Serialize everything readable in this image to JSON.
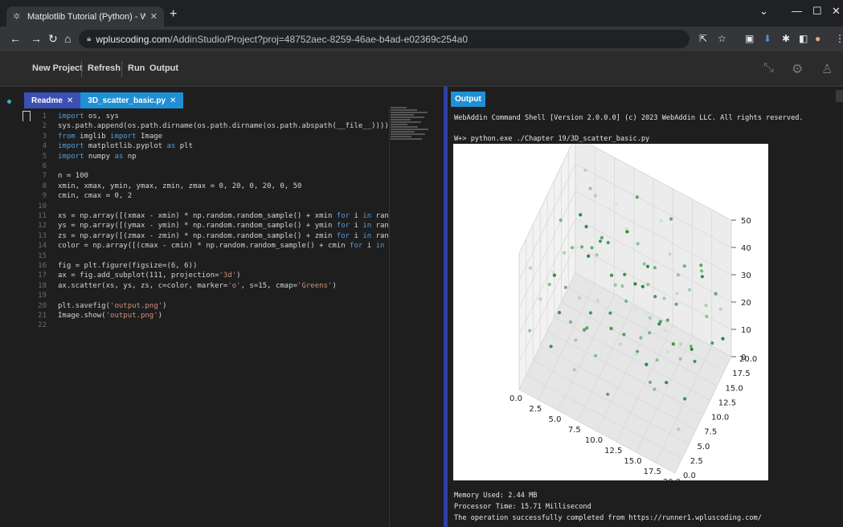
{
  "browser": {
    "tab_title": "Matplotlib Tutorial (Python) - W",
    "url_host": "wpluscoding.com",
    "url_path": "/AddinStudio/Project?proj=48752aec-8259-46ae-b4ad-e02369c254a0",
    "favicon": "wplus-icon"
  },
  "toolbar": {
    "new_project": "New Project",
    "refresh": "Refresh",
    "run": "Run",
    "output": "Output"
  },
  "editor": {
    "tabs": [
      {
        "label": "Readme"
      },
      {
        "label": "3D_scatter_basic.py"
      }
    ],
    "lines": [
      {
        "n": "1",
        "text": "import os, sys"
      },
      {
        "n": "2",
        "text": "sys.path.append(os.path.dirname(os.path.dirname(os.path.abspath(__file__))))"
      },
      {
        "n": "3",
        "text": "from imglib import Image"
      },
      {
        "n": "4",
        "text": "import matplotlib.pyplot as plt"
      },
      {
        "n": "5",
        "text": "import numpy as np"
      },
      {
        "n": "6",
        "text": ""
      },
      {
        "n": "7",
        "text": "n = 100"
      },
      {
        "n": "8",
        "text": "xmin, xmax, ymin, ymax, zmin, zmax = 0, 20, 0, 20, 0, 50"
      },
      {
        "n": "9",
        "text": "cmin, cmax = 0, 2"
      },
      {
        "n": "10",
        "text": ""
      },
      {
        "n": "11",
        "text": "xs = np.array([(xmax - xmin) * np.random.random_sample() + xmin for i in rang"
      },
      {
        "n": "12",
        "text": "ys = np.array([(ymax - ymin) * np.random.random_sample() + ymin for i in rang"
      },
      {
        "n": "13",
        "text": "zs = np.array([(zmax - zmin) * np.random.random_sample() + zmin for i in rang"
      },
      {
        "n": "14",
        "text": "color = np.array([(cmax - cmin) * np.random.random_sample() + cmin for i in r"
      },
      {
        "n": "15",
        "text": ""
      },
      {
        "n": "16",
        "text": "fig = plt.figure(figsize=(6, 6))"
      },
      {
        "n": "17",
        "text": "ax = fig.add_subplot(111, projection='3d')"
      },
      {
        "n": "18",
        "text": "ax.scatter(xs, ys, zs, c=color, marker='o', s=15, cmap='Greens')"
      },
      {
        "n": "19",
        "text": ""
      },
      {
        "n": "20",
        "text": "plt.savefig('output.png')"
      },
      {
        "n": "21",
        "text": "Image.show('output.png')"
      },
      {
        "n": "22",
        "text": ""
      }
    ]
  },
  "output": {
    "tab_label": "Output",
    "header": "WebAddin Command Shell [Version 2.0.0.0] (c) 2023 WebAddin LLC. All rights reserved.",
    "command": "W+> python.exe ./Chapter 19/3D_scatter_basic.py",
    "memory": "Memory Used: 2.44 MB",
    "processor": "Processor Time: 15.71 Millisecond",
    "status": "The operation successfully completed from https://runner1.wpluscoding.com/"
  },
  "chart_data": {
    "type": "scatter",
    "projection": "3d",
    "cmap": "Greens",
    "xlim": [
      0,
      20
    ],
    "ylim": [
      0,
      20
    ],
    "zlim": [
      0,
      50
    ],
    "x_ticks": [
      "0.0",
      "2.5",
      "5.0",
      "7.5",
      "10.0",
      "12.5",
      "15.0",
      "17.5",
      "20.0"
    ],
    "y_ticks": [
      "0.0",
      "2.5",
      "5.0",
      "7.5",
      "10.0",
      "12.5",
      "15.0",
      "17.5",
      "20.0"
    ],
    "z_ticks": [
      "0",
      "10",
      "20",
      "30",
      "40",
      "50"
    ],
    "grid": true,
    "points": [
      {
        "x": 2,
        "y": 18,
        "z": 45,
        "c": 0.5
      },
      {
        "x": 5,
        "y": 15,
        "z": 30,
        "c": 1.6
      },
      {
        "x": 8,
        "y": 12,
        "z": 25,
        "c": 0.8
      },
      {
        "x": 12,
        "y": 8,
        "z": 40,
        "c": 1.9
      },
      {
        "x": 15,
        "y": 5,
        "z": 15,
        "c": 1.2
      },
      {
        "x": 18,
        "y": 3,
        "z": 35,
        "c": 0.3
      },
      {
        "x": 3,
        "y": 6,
        "z": 20,
        "c": 1.7
      },
      {
        "x": 6,
        "y": 3,
        "z": 10,
        "c": 0.6
      },
      {
        "x": 9,
        "y": 17,
        "z": 48,
        "c": 1.4
      },
      {
        "x": 11,
        "y": 14,
        "z": 33,
        "c": 0.9
      },
      {
        "x": 14,
        "y": 11,
        "z": 22,
        "c": 1.8
      },
      {
        "x": 17,
        "y": 9,
        "z": 42,
        "c": 0.4
      },
      {
        "x": 19,
        "y": 16,
        "z": 12,
        "c": 1.5
      },
      {
        "x": 1,
        "y": 12,
        "z": 38,
        "c": 1.1
      },
      {
        "x": 4,
        "y": 9,
        "z": 5,
        "c": 0.7
      },
      {
        "x": 7,
        "y": 19,
        "z": 28,
        "c": 1.9
      },
      {
        "x": 10,
        "y": 2,
        "z": 18,
        "c": 0.2
      },
      {
        "x": 13,
        "y": 18,
        "z": 44,
        "c": 1.3
      },
      {
        "x": 16,
        "y": 13,
        "z": 8,
        "c": 0.8
      },
      {
        "x": 20,
        "y": 7,
        "z": 26,
        "c": 1.6
      },
      {
        "x": 2,
        "y": 2,
        "z": 32,
        "c": 0.5
      },
      {
        "x": 5,
        "y": 10,
        "z": 46,
        "c": 1.8
      },
      {
        "x": 8,
        "y": 5,
        "z": 14,
        "c": 1.0
      },
      {
        "x": 11,
        "y": 20,
        "z": 36,
        "c": 0.3
      },
      {
        "x": 14,
        "y": 16,
        "z": 4,
        "c": 1.7
      },
      {
        "x": 17,
        "y": 1,
        "z": 24,
        "c": 0.9
      },
      {
        "x": 19,
        "y": 12,
        "z": 49,
        "c": 1.4
      },
      {
        "x": 0,
        "y": 16,
        "z": 16,
        "c": 0.6
      },
      {
        "x": 3,
        "y": 14,
        "z": 27,
        "c": 1.2
      },
      {
        "x": 6,
        "y": 8,
        "z": 41,
        "c": 1.9
      },
      {
        "x": 9,
        "y": 11,
        "z": 7,
        "c": 0.4
      },
      {
        "x": 12,
        "y": 4,
        "z": 30,
        "c": 1.5
      },
      {
        "x": 15,
        "y": 19,
        "z": 19,
        "c": 0.7
      },
      {
        "x": 18,
        "y": 15,
        "z": 39,
        "c": 1.1
      },
      {
        "x": 4,
        "y": 1,
        "z": 47,
        "c": 0.2
      },
      {
        "x": 7,
        "y": 13,
        "z": 11,
        "c": 1.6
      },
      {
        "x": 10,
        "y": 9,
        "z": 34,
        "c": 0.8
      },
      {
        "x": 13,
        "y": 6,
        "z": 21,
        "c": 1.3
      },
      {
        "x": 16,
        "y": 17,
        "z": 3,
        "c": 1.9
      },
      {
        "x": 20,
        "y": 2,
        "z": 43,
        "c": 0.5
      },
      {
        "x": 1,
        "y": 8,
        "z": 23,
        "c": 1.0
      },
      {
        "x": 5,
        "y": 19,
        "z": 9,
        "c": 1.7
      },
      {
        "x": 8,
        "y": 16,
        "z": 37,
        "c": 0.3
      },
      {
        "x": 11,
        "y": 1,
        "z": 13,
        "c": 1.4
      },
      {
        "x": 14,
        "y": 7,
        "z": 45,
        "c": 0.9
      },
      {
        "x": 17,
        "y": 18,
        "z": 29,
        "c": 1.8
      },
      {
        "x": 19,
        "y": 4,
        "z": 6,
        "c": 0.6
      },
      {
        "x": 2,
        "y": 11,
        "z": 17,
        "c": 1.2
      },
      {
        "x": 6,
        "y": 15,
        "z": 31,
        "c": 1.5
      },
      {
        "x": 9,
        "y": 3,
        "z": 40,
        "c": 0.4
      },
      {
        "x": 12,
        "y": 12,
        "z": 2,
        "c": 1.9
      },
      {
        "x": 15,
        "y": 10,
        "z": 35,
        "c": 0.7
      },
      {
        "x": 18,
        "y": 20,
        "z": 20,
        "c": 1.3
      },
      {
        "x": 3,
        "y": 17,
        "z": 42,
        "c": 0.8
      },
      {
        "x": 7,
        "y": 6,
        "z": 26,
        "c": 1.6
      },
      {
        "x": 10,
        "y": 14,
        "z": 15,
        "c": 0.2
      },
      {
        "x": 13,
        "y": 2,
        "z": 48,
        "c": 1.1
      },
      {
        "x": 16,
        "y": 8,
        "z": 10,
        "c": 1.8
      },
      {
        "x": 0,
        "y": 4,
        "z": 36,
        "c": 0.5
      },
      {
        "x": 4,
        "y": 13,
        "z": 1,
        "c": 1.4
      },
      {
        "x": 8,
        "y": 20,
        "z": 23,
        "c": 0.9
      },
      {
        "x": 11,
        "y": 7,
        "z": 44,
        "c": 1.7
      },
      {
        "x": 14,
        "y": 3,
        "z": 28,
        "c": 0.3
      },
      {
        "x": 17,
        "y": 14,
        "z": 12,
        "c": 1.2
      },
      {
        "x": 20,
        "y": 11,
        "z": 38,
        "c": 0.6
      },
      {
        "x": 1,
        "y": 19,
        "z": 25,
        "c": 1.9
      },
      {
        "x": 5,
        "y": 5,
        "z": 49,
        "c": 1.0
      },
      {
        "x": 9,
        "y": 8,
        "z": 19,
        "c": 0.4
      },
      {
        "x": 12,
        "y": 17,
        "z": 7,
        "c": 1.5
      },
      {
        "x": 15,
        "y": 15,
        "z": 33,
        "c": 0.8
      },
      {
        "x": 18,
        "y": 6,
        "z": 46,
        "c": 1.3
      },
      {
        "x": 3,
        "y": 3,
        "z": 14,
        "c": 1.7
      },
      {
        "x": 6,
        "y": 18,
        "z": 39,
        "c": 0.2
      },
      {
        "x": 10,
        "y": 5,
        "z": 27,
        "c": 1.6
      },
      {
        "x": 13,
        "y": 13,
        "z": 3,
        "c": 0.9
      },
      {
        "x": 16,
        "y": 2,
        "z": 41,
        "c": 1.1
      },
      {
        "x": 19,
        "y": 19,
        "z": 18,
        "c": 0.5
      },
      {
        "x": 2,
        "y": 7,
        "z": 30,
        "c": 1.8
      },
      {
        "x": 7,
        "y": 10,
        "z": 45,
        "c": 1.4
      },
      {
        "x": 11,
        "y": 16,
        "z": 9,
        "c": 0.7
      },
      {
        "x": 14,
        "y": 20,
        "z": 24,
        "c": 1.2
      },
      {
        "x": 17,
        "y": 5,
        "z": 37,
        "c": 0.3
      },
      {
        "x": 20,
        "y": 17,
        "z": 13,
        "c": 1.9
      },
      {
        "x": 4,
        "y": 16,
        "z": 43,
        "c": 0.6
      },
      {
        "x": 8,
        "y": 1,
        "z": 32,
        "c": 1.5
      },
      {
        "x": 12,
        "y": 10,
        "z": 16,
        "c": 1.0
      },
      {
        "x": 15,
        "y": 12,
        "z": 47,
        "c": 0.4
      },
      {
        "x": 18,
        "y": 9,
        "z": 5,
        "c": 1.7
      },
      {
        "x": 1,
        "y": 1,
        "z": 21,
        "c": 0.8
      },
      {
        "x": 5,
        "y": 12,
        "z": 34,
        "c": 1.3
      },
      {
        "x": 9,
        "y": 19,
        "z": 11,
        "c": 1.9
      },
      {
        "x": 13,
        "y": 9,
        "z": 29,
        "c": 0.2
      },
      {
        "x": 16,
        "y": 4,
        "z": 50,
        "c": 1.6
      },
      {
        "x": 19,
        "y": 14,
        "z": 26,
        "c": 0.9
      },
      {
        "x": 3,
        "y": 10,
        "z": 8,
        "c": 1.1
      },
      {
        "x": 7,
        "y": 2,
        "z": 40,
        "c": 0.5
      },
      {
        "x": 10,
        "y": 18,
        "z": 22,
        "c": 1.8
      },
      {
        "x": 14,
        "y": 14,
        "z": 17,
        "c": 1.4
      },
      {
        "x": 6,
        "y": 11,
        "z": 35,
        "c": 0.7
      },
      {
        "x": 12,
        "y": 15,
        "z": 31,
        "c": 1.2
      }
    ]
  }
}
